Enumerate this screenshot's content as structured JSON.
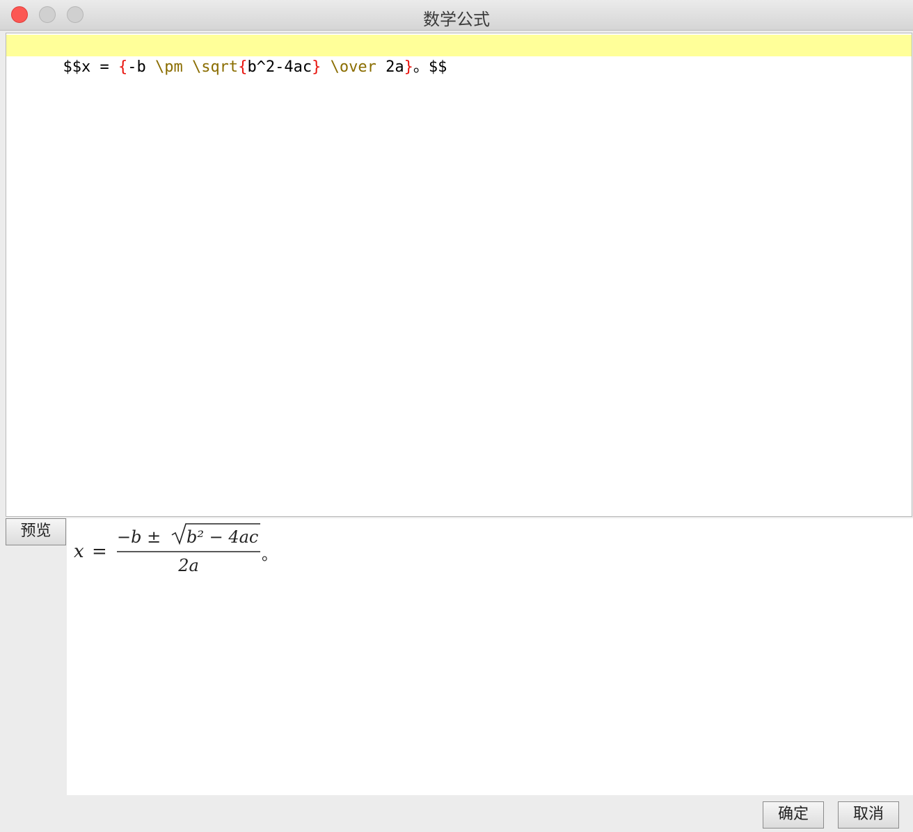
{
  "window": {
    "title": "数学公式"
  },
  "editor": {
    "line": [
      {
        "text": "$$x = ",
        "kind": "plain"
      },
      {
        "text": "{",
        "kind": "brace"
      },
      {
        "text": "-b ",
        "kind": "plain"
      },
      {
        "text": "\\pm \\sqrt",
        "kind": "cmd"
      },
      {
        "text": "{",
        "kind": "brace"
      },
      {
        "text": "b^2-4ac",
        "kind": "plain"
      },
      {
        "text": "}",
        "kind": "brace"
      },
      {
        "text": " \\over ",
        "kind": "cmd"
      },
      {
        "text": "2a",
        "kind": "plain"
      },
      {
        "text": "}",
        "kind": "brace"
      },
      {
        "text": "。$$",
        "kind": "plain"
      }
    ],
    "highlight_color": "#ffff99",
    "brace_color": "#e8120c",
    "command_color": "#8a6d00"
  },
  "preview": {
    "button_label": "预览",
    "formula": {
      "lhs": "x",
      "equals": "=",
      "numerator_prefix": "−b ± ",
      "radicand": "b² − 4ac",
      "denominator": "2a",
      "suffix": "。"
    }
  },
  "footer": {
    "ok_label": "确定",
    "cancel_label": "取消"
  }
}
